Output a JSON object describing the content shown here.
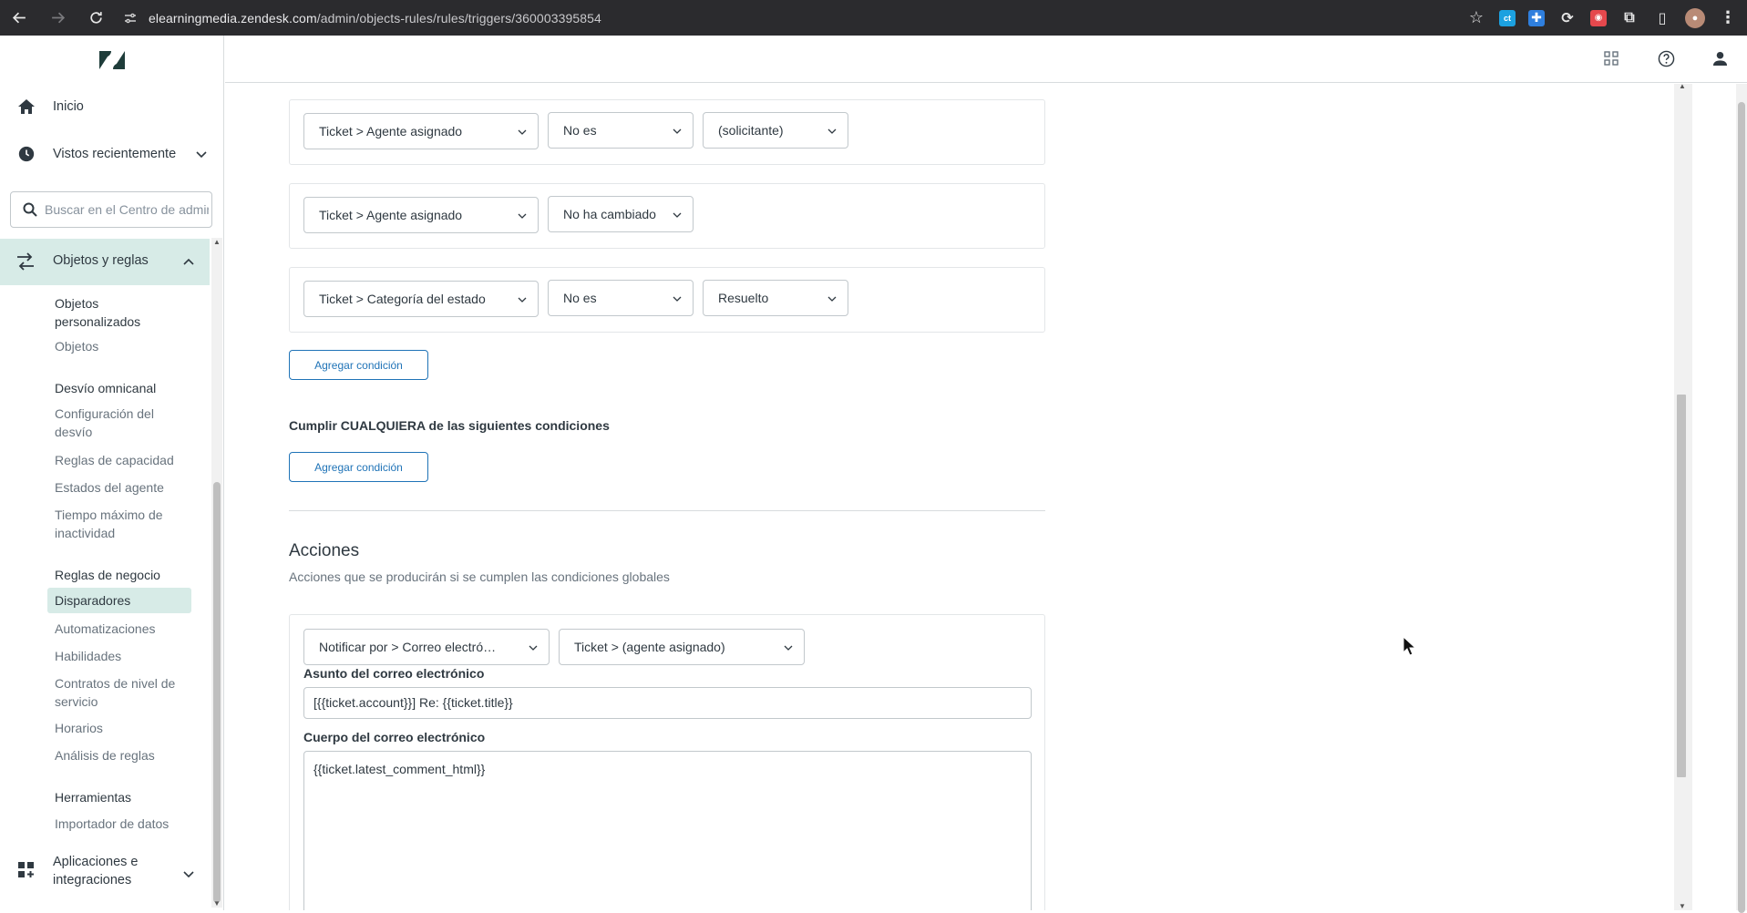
{
  "browser": {
    "url_host": "elearningmedia.zendesk.com",
    "url_path": "/admin/objects-rules/rules/triggers/360003395854"
  },
  "nav": {
    "home": "Inicio",
    "recent": "Vistos recientemente",
    "search_placeholder": "Buscar en el Centro de administración",
    "section": "Objetos y reglas",
    "items": {
      "custom_objects": "Objetos personalizados",
      "objects": "Objetos",
      "omnichannel_head": "Desvío omnicanal",
      "routing_config": "Configuración del desvío",
      "capacity_rules": "Reglas de capacidad",
      "agent_states": "Estados del agente",
      "max_inactivity": "Tiempo máximo de inactividad",
      "business_rules_head": "Reglas de negocio",
      "triggers": "Disparadores",
      "automations": "Automatizaciones",
      "skills": "Habilidades",
      "sla": "Contratos de nivel de servicio",
      "schedules": "Horarios",
      "rule_analysis": "Análisis de reglas",
      "tools_head": "Herramientas",
      "data_importer": "Importador de datos"
    },
    "apps": "Aplicaciones e integraciones"
  },
  "conditions_all": [
    {
      "field": "Ticket > Agente asignado",
      "operator": "No es",
      "value": "(solicitante)"
    },
    {
      "field": "Ticket > Agente asignado",
      "operator": "No ha cambiado",
      "value": ""
    },
    {
      "field": "Ticket > Categoría del estado",
      "operator": "No es",
      "value": "Resuelto"
    }
  ],
  "add_condition_label": "Agregar condición",
  "any_heading": "Cumplir CUALQUIERA de las siguientes condiciones",
  "actions": {
    "title": "Acciones",
    "subtitle": "Acciones que se producirán si se cumplen las condiciones globales",
    "action_type": "Notificar por > Correo electró…",
    "recipient": "Ticket > (agente asignado)",
    "subject_label": "Asunto del correo electrónico",
    "subject_value": "[{{ticket.account}}] Re: {{ticket.title}}",
    "body_label": "Cuerpo del correo electrónico",
    "body_value": "{{ticket.latest_comment_html}}"
  }
}
